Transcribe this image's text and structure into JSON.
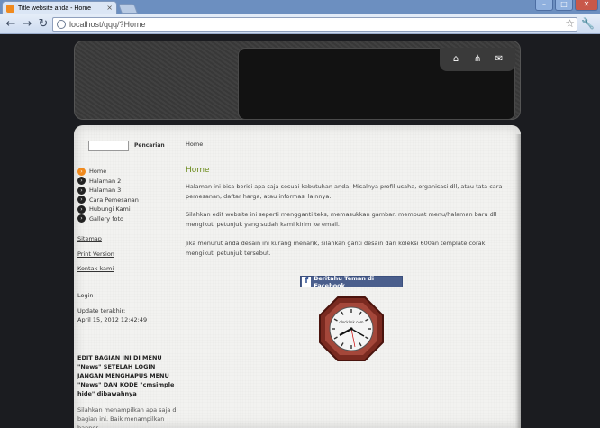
{
  "browser": {
    "tab_title": "Title website anda - Home",
    "url": "localhost/qqq/?Home",
    "controls": {
      "minimize": "–",
      "maximize": "□",
      "close": "✕"
    },
    "nav": {
      "back": "←",
      "forward": "→",
      "reload": "↻"
    }
  },
  "header": {
    "icons": [
      "home-icon",
      "sitemap-icon",
      "mail-icon"
    ]
  },
  "sidebar": {
    "search_label": "Pencarian",
    "menu": [
      {
        "label": "Home",
        "active": true
      },
      {
        "label": "Halaman 2",
        "active": false
      },
      {
        "label": "Halaman 3",
        "active": false
      },
      {
        "label": "Cara Pemesanan",
        "active": false
      },
      {
        "label": "Hubungi Kami",
        "active": false
      },
      {
        "label": "Gallery foto",
        "active": false
      }
    ],
    "links": {
      "sitemap": "Sitemap",
      "print": "Print Version",
      "contact": "Kontak kami"
    },
    "login": "Login",
    "update_label": "Update terakhir:",
    "update_date": "April 15, 2012 12:42:49",
    "edit_note": "EDIT BAGIAN INI DI MENU \"News\" SETELAH LOGIN JANGAN MENGHAPUS MENU \"News\" DAN KODE \"cmsimple hide\" dibawahnya",
    "edit_desc": "Silahkan menampilkan apa saja di bagian ini. Baik menampilkan banner,"
  },
  "main": {
    "breadcrumb": "Home",
    "title": "Home",
    "paragraphs": [
      "Halaman ini bisa berisi apa saja sesuai kebutuhan anda. Misalnya profil usaha, organisasi dll, atau tata cara pemesanan, daftar harga, atau informasi lainnya.",
      "Silahkan edit website ini seperti mengganti teks, memasukkan gambar, membuat menu/halaman baru dll mengikuti petunjuk yang sudah kami kirim ke email.",
      "Jika menurut anda desain ini kurang menarik, silahkan ganti desain dari koleksi 600an template corak mengikuti petunjuk tersebut."
    ],
    "facebook_button": "Beritahu Teman di Facebook",
    "clock_brand": "clocklink.com"
  },
  "colors": {
    "accent_title": "#6a8a19",
    "facebook": "#4a5e8c",
    "active_bullet": "#f08a1e"
  }
}
